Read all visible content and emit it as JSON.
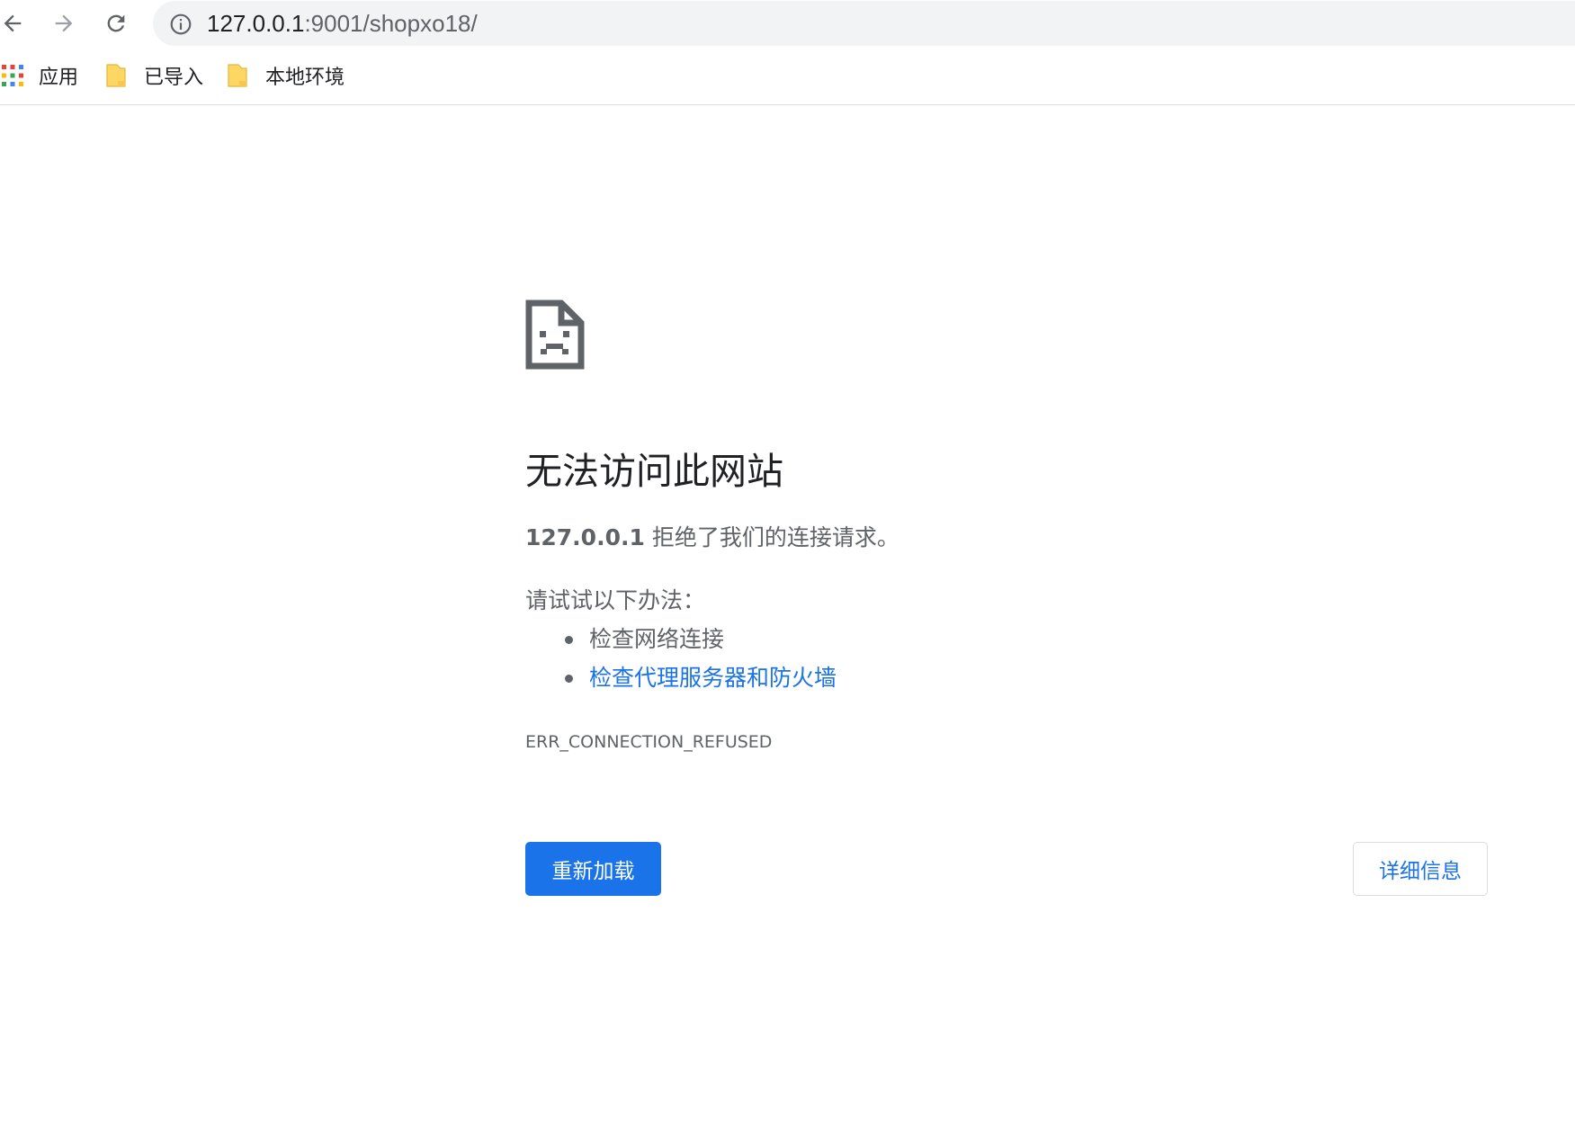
{
  "browser": {
    "url_host": "127.0.0.1",
    "url_path": ":9001/shopxo18/",
    "icons": {
      "back": "arrow-left-icon",
      "forward": "arrow-right-icon",
      "reload": "reload-icon",
      "site_info": "info-icon"
    }
  },
  "bookmarks": [
    {
      "label": "应用",
      "icon": "apps-grid-icon"
    },
    {
      "label": "已导入",
      "icon": "folder-icon"
    },
    {
      "label": "本地环境",
      "icon": "folder-icon"
    }
  ],
  "error": {
    "icon": "sad-document-icon",
    "title": "无法访问此网站",
    "host": "127.0.0.1",
    "summary": " 拒绝了我们的连接请求。",
    "suggestions_heading": "请试试以下办法：",
    "suggestions": [
      {
        "label": "检查网络连接",
        "is_link": false
      },
      {
        "label": "检查代理服务器和防火墙",
        "is_link": true
      }
    ],
    "code": "ERR_CONNECTION_REFUSED"
  },
  "buttons": {
    "reload_label": "重新加载",
    "details_label": "详细信息"
  },
  "colors": {
    "accent": "#1a73e8",
    "text_primary": "#202124",
    "text_secondary": "#5f6368",
    "omnibox_bg": "#f1f3f4",
    "folder_yellow": "#fdd663"
  }
}
